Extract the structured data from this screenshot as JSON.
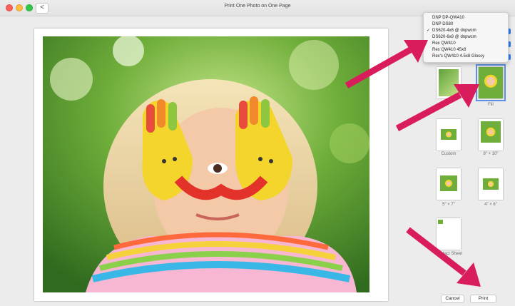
{
  "window": {
    "title": "Print One Photo on One Page",
    "back_symbol": "<"
  },
  "printer_menu": {
    "items": [
      "DNP DP-QW410",
      "DNP DS80",
      "DS620-4x6 @ dnpwcm",
      "DS620-6x8 @ dnpwcm",
      "Rex QW410",
      "Rex QW410 45x8",
      "Rex's QW410 4.5x8 Glossy"
    ],
    "checked_index": 2,
    "check_symbol": "✓"
  },
  "layouts": [
    {
      "label": "",
      "selected": false
    },
    {
      "label": "Fill",
      "selected": true
    },
    {
      "label": "Custom",
      "selected": false
    },
    {
      "label": "8\" × 10\"",
      "selected": false
    },
    {
      "label": "5\" × 7\"",
      "selected": false
    },
    {
      "label": "4\" × 6\"",
      "selected": false
    },
    {
      "label": "Contact Sheet",
      "selected": false
    }
  ],
  "buttons": {
    "cancel": "Cancel",
    "print": "Print"
  },
  "colors": {
    "accent": "#2e7cf6",
    "arrow": "#d81c5c",
    "selection": "#5b8fe2"
  },
  "icons": {
    "close": "close-icon",
    "minimize": "minimize-icon",
    "zoom": "zoom-icon",
    "back": "chevron-left-icon"
  }
}
